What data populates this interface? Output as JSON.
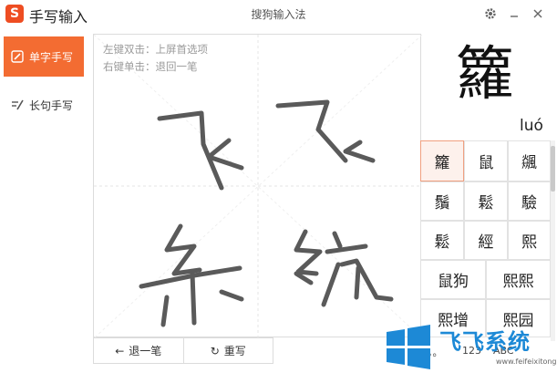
{
  "app": {
    "logo_letter": "S",
    "title": "手写输入",
    "center_title": "搜狗输入法"
  },
  "window": {
    "settings_icon": "gear-icon",
    "minimize_icon": "minimize-icon",
    "close_icon": "close-icon"
  },
  "sidebar": {
    "items": [
      {
        "label": "单字手写",
        "icon": "pencil-icon",
        "active": true
      },
      {
        "label": "长句手写",
        "icon": "sentence-pen-icon",
        "active": false
      }
    ]
  },
  "pad": {
    "hint_1": "左键双击：上屏首选项",
    "hint_2": "右键单击：退回一笔",
    "undo_label": "退一笔",
    "rewrite_label": "重写",
    "undo_icon": "arrow-left-icon",
    "rewrite_icon": "refresh-icon"
  },
  "preview": {
    "char": "籮",
    "pinyin": "luó"
  },
  "candidates": {
    "row1": [
      "籮",
      "鼠",
      "飊"
    ],
    "row2": [
      "鬚",
      "鬆",
      "驗"
    ],
    "row3": [
      "鬆",
      "經",
      "熙"
    ],
    "row4": [
      "鼠狗",
      "熙熙"
    ],
    "row5": [
      "熙增",
      "熙园"
    ]
  },
  "status": {
    "punct": "，。",
    "num": "123",
    "alpha": "ABC"
  },
  "watermark": {
    "text": "飞飞系统",
    "url": "www.feifeixitong.com"
  },
  "colors": {
    "accent": "#f36c32",
    "stroke": "#5a5a5a",
    "brand_blue": "#1d89d6"
  }
}
